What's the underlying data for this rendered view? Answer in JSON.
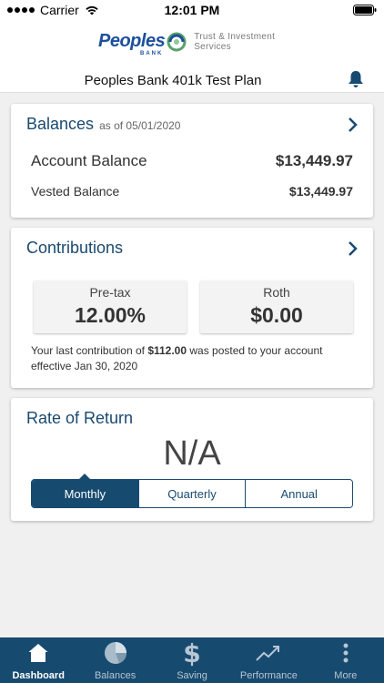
{
  "status": {
    "carrier": "Carrier",
    "time": "12:01 PM"
  },
  "header": {
    "logo_name": "Peoples",
    "logo_sub": "BANK",
    "logo_tagline_1": "Trust & Investment",
    "logo_tagline_2": "Services",
    "plan_title": "Peoples Bank 401k Test Plan"
  },
  "balances": {
    "title": "Balances",
    "as_of": "as of 05/01/2020",
    "account_label": "Account Balance",
    "account_value": "$13,449.97",
    "vested_label": "Vested Balance",
    "vested_value": "$13,449.97"
  },
  "contributions": {
    "title": "Contributions",
    "pretax_label": "Pre-tax",
    "pretax_value": "12.00%",
    "roth_label": "Roth",
    "roth_value": "$0.00",
    "note_prefix": "Your last contribution of ",
    "note_amount": "$112.00",
    "note_suffix": " was posted to your account effective Jan 30, 2020"
  },
  "rate_of_return": {
    "title": "Rate of Return",
    "value": "N/A",
    "periods": [
      "Monthly",
      "Quarterly",
      "Annual"
    ],
    "selected": "Monthly"
  },
  "tabs": [
    {
      "label": "Dashboard",
      "icon": "home-icon",
      "active": true
    },
    {
      "label": "Balances",
      "icon": "pie-chart-icon",
      "active": false
    },
    {
      "label": "Saving",
      "icon": "dollar-icon",
      "active": false
    },
    {
      "label": "Performance",
      "icon": "trend-icon",
      "active": false
    },
    {
      "label": "More",
      "icon": "more-icon",
      "active": false
    }
  ],
  "colors": {
    "primary": "#174a6f",
    "brand_blue": "#1c4f9c",
    "brand_green": "#5aa26a"
  }
}
